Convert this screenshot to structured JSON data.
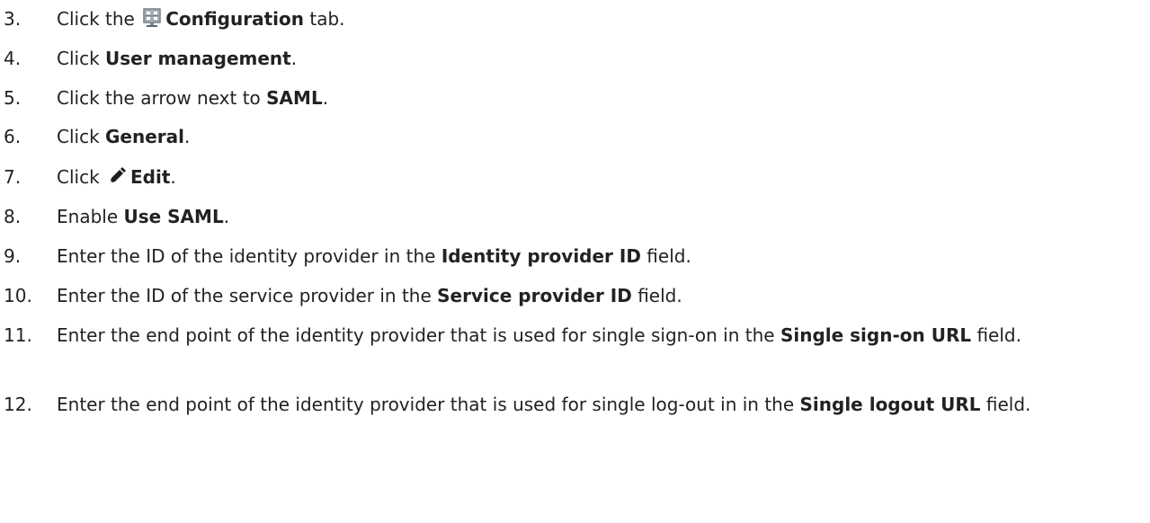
{
  "steps": [
    {
      "num": "3.",
      "pre": "Click the",
      "bold": "Configuration",
      "post": "tab.",
      "icon": "configuration-icon"
    },
    {
      "num": "4.",
      "pre": "Click",
      "bold": "User management",
      "post": "."
    },
    {
      "num": "5.",
      "pre": "Click the arrow next to",
      "bold": "SAML",
      "post": "."
    },
    {
      "num": "6.",
      "pre": "Click",
      "bold": "General",
      "post": "."
    },
    {
      "num": "7.",
      "pre": "Click",
      "bold": "Edit",
      "post": ".",
      "icon": "pencil-icon"
    },
    {
      "num": "8.",
      "pre": "Enable",
      "bold": "Use SAML",
      "post": "."
    },
    {
      "num": "9.",
      "pre": "Enter the ID of the identity provider in the",
      "bold": "Identity provider ID",
      "post": "field."
    },
    {
      "num": "10.",
      "pre": "Enter the ID of the service provider in the",
      "bold": "Service provider ID",
      "post": "field."
    },
    {
      "num": "11.",
      "pre": "Enter the end point of the identity provider that is used for single sign-on in the",
      "bold": "Single sign-on URL",
      "post": "field."
    },
    {
      "num": "12.",
      "pre": "Enter the end point of the identity provider that is used for single log-out in in the",
      "bold": "Single logout URL",
      "post": "field."
    }
  ]
}
